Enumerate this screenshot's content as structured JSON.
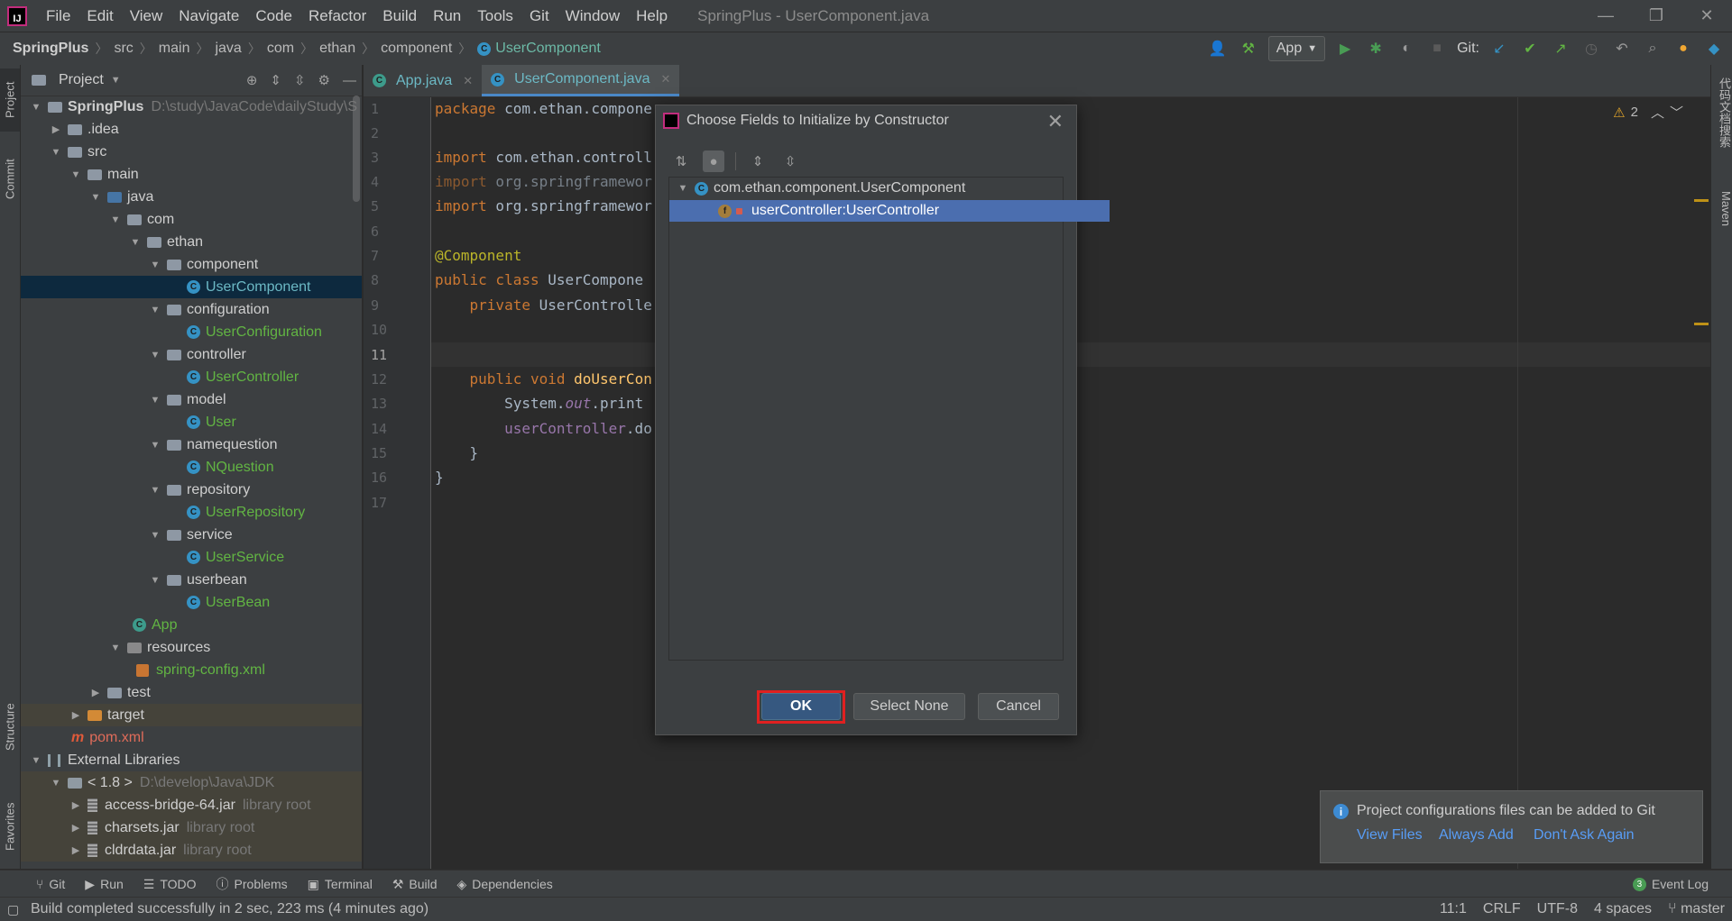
{
  "window": {
    "logo_text": "IJ",
    "title": "SpringPlus - UserComponent.java",
    "minimize_label": "—",
    "restore_label": "❐",
    "close_label": "✕"
  },
  "menu": [
    "File",
    "Edit",
    "View",
    "Navigate",
    "Code",
    "Refactor",
    "Build",
    "Run",
    "Tools",
    "Git",
    "Window",
    "Help"
  ],
  "breadcrumb": [
    "SpringPlus",
    "src",
    "main",
    "java",
    "com",
    "ethan",
    "component",
    "UserComponent"
  ],
  "toolbar": {
    "run_config": "App",
    "git_label": "Git:"
  },
  "left_strip": [
    "Project",
    "Commit",
    "Structure",
    "Favorites"
  ],
  "right_strip": [
    "代码文档搜索",
    "Maven"
  ],
  "project_panel": {
    "title": "Project",
    "tree": {
      "root": "SpringPlus",
      "root_path": "D:\\study\\JavaCode\\dailyStudy\\S",
      "idea": ".idea",
      "src": "src",
      "main": "main",
      "java": "java",
      "com": "com",
      "ethan": "ethan",
      "component": "component",
      "user_component": "UserComponent",
      "configuration": "configuration",
      "user_configuration": "UserConfiguration",
      "controller": "controller",
      "user_controller": "UserController",
      "model": "model",
      "user": "User",
      "namequestion": "namequestion",
      "nquestion": "NQuestion",
      "repository": "repository",
      "user_repository": "UserRepository",
      "service": "service",
      "user_service": "UserService",
      "userbean": "userbean",
      "user_bean": "UserBean",
      "app": "App",
      "resources": "resources",
      "spring_config": "spring-config.xml",
      "test": "test",
      "target": "target",
      "pom": "pom.xml",
      "external_libraries": "External Libraries",
      "jdk": "< 1.8 >",
      "jdk_path": "D:\\develop\\Java\\JDK",
      "jar1": "access-bridge-64.jar",
      "jar2": "charsets.jar",
      "jar3": "cldrdata.jar",
      "library_root": "library root"
    }
  },
  "editor": {
    "tabs": [
      {
        "label": "App.java"
      },
      {
        "label": "UserComponent.java"
      }
    ],
    "line_numbers": [
      "1",
      "2",
      "3",
      "4",
      "5",
      "6",
      "7",
      "8",
      "9",
      "10",
      "11",
      "12",
      "13",
      "14",
      "15",
      "16",
      "17"
    ],
    "warnings_count": "2",
    "code": {
      "l1_kw": "package",
      "l1_rest": " com.ethan.compone",
      "l3_kw": "import",
      "l3_rest": " com.ethan.controll",
      "l4_kw": "import",
      "l4_rest": " org.springframewor",
      "l5_kw": "import",
      "l5_rest": " org.springframewor",
      "l7": "@Component",
      "l8_kw": "public class",
      "l8_rest": " UserCompone",
      "l9_kw": "    private",
      "l9_rest": " UserControlle",
      "l12_kw": "    public void",
      "l12_fn": " doUserCon",
      "l13_a": "        System.",
      "l13_b": "out",
      "l13_c": ".print",
      "l14_a": "        ",
      "l14_b": "userController",
      "l14_c": ".do",
      "l15": "    }",
      "l16": "}"
    }
  },
  "dialog": {
    "title": "Choose Fields to Initialize by Constructor",
    "class_node": "com.ethan.component.UserComponent",
    "field_node": "userController:UserController",
    "ok_label": "OK",
    "select_none_label": "Select None",
    "cancel_label": "Cancel"
  },
  "notification": {
    "message": "Project configurations files can be added to Git",
    "actions": [
      "View Files",
      "Always Add",
      "Don't Ask Again"
    ]
  },
  "bottom_tools": [
    "Git",
    "Run",
    "TODO",
    "Problems",
    "Terminal",
    "Build",
    "Dependencies"
  ],
  "event_log": {
    "label": "Event Log",
    "count": "3"
  },
  "status": {
    "message": "Build completed successfully in 2 sec, 223 ms (4 minutes ago)",
    "position": "11:1",
    "line_sep": "CRLF",
    "encoding": "UTF-8",
    "indent": "4 spaces",
    "branch": "master"
  }
}
